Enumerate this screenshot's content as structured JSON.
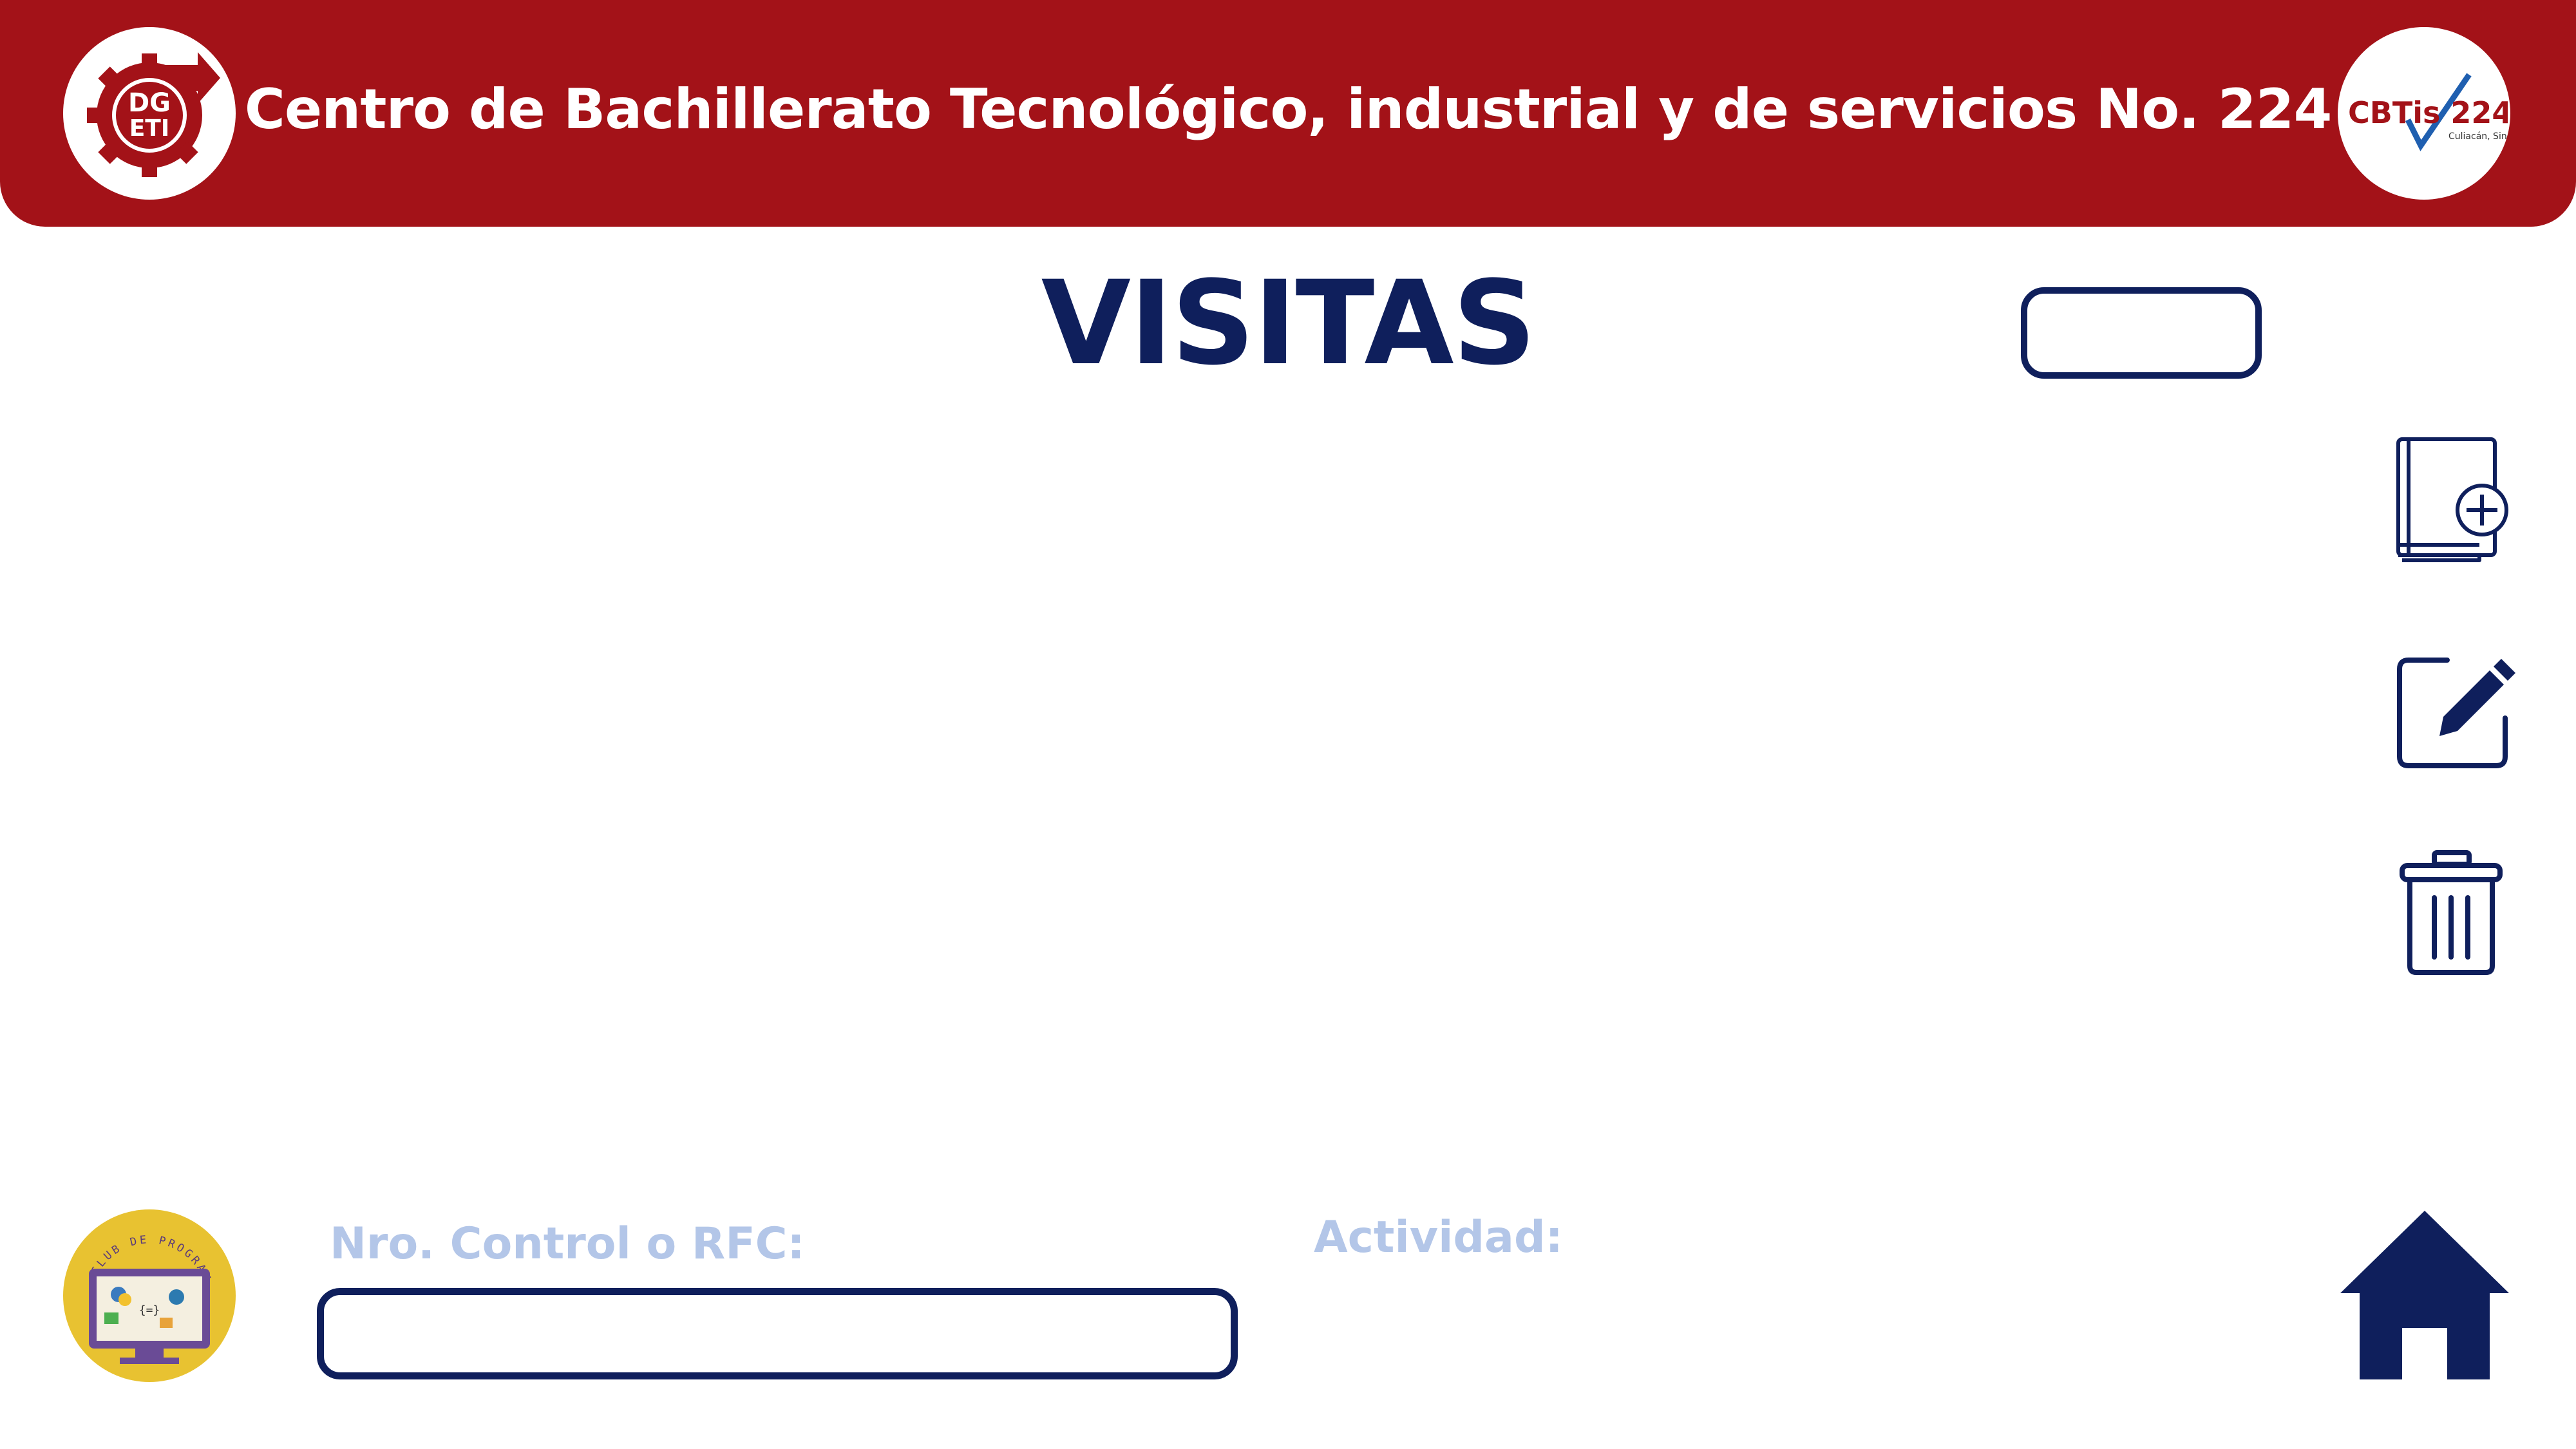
{
  "header": {
    "title": "Centro de Bachillerato Tecnológico, industrial y de servicios No. 224",
    "left_logo": {
      "icon": "dgeti-gear-logo-icon",
      "text": "DG ETI"
    },
    "right_logo": {
      "icon": "cbtis-224-logo-icon",
      "text": "CBTis 224",
      "subtext": "Culiacán, Sin."
    }
  },
  "main": {
    "title": "VISITAS"
  },
  "side_actions": [
    {
      "name": "add-record-button",
      "icon": "book-plus-icon"
    },
    {
      "name": "edit-record-button",
      "icon": "pencil-square-icon"
    },
    {
      "name": "delete-record-button",
      "icon": "trash-icon"
    }
  ],
  "form": {
    "control_label": "Nro. Control o RFC:",
    "control_value": "",
    "activity_label": "Actividad:"
  },
  "footer": {
    "club_logo": {
      "icon": "club-programacion-logo-icon",
      "text": "CLUB DE PROGRAMACIÓN"
    },
    "home_icon": "home-icon"
  },
  "colors": {
    "header_red": "#a31218",
    "navy": "#0f1f5c",
    "label_light_blue": "#b3c6e8",
    "club_yellow": "#e8c231"
  }
}
